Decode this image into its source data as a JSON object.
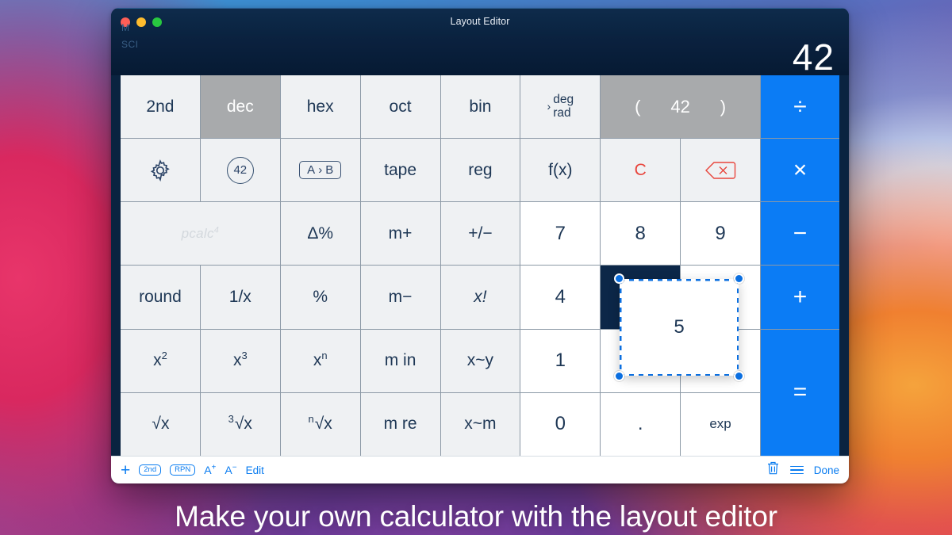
{
  "window": {
    "title": "Layout Editor",
    "traffic_lights": [
      "close",
      "minimize",
      "zoom"
    ]
  },
  "display": {
    "flag_memory": "M",
    "flag_mode": "SCI",
    "value": "42"
  },
  "colors": {
    "accent_blue": "#0b7cf5",
    "toolbar_blue": "#0a7cf0",
    "key_face": "#eff1f3",
    "number_key_face": "#ffffff",
    "gray_key": "#a8aaac",
    "selected_slot": "#0c2748",
    "red": "#e8453c",
    "text": "#1e3755"
  },
  "keypad": {
    "rows": [
      [
        {
          "name": "2nd",
          "label": "2nd",
          "style": "func"
        },
        {
          "name": "dec",
          "label": "dec",
          "style": "gray"
        },
        {
          "name": "hex",
          "label": "hex",
          "style": "func"
        },
        {
          "name": "oct",
          "label": "oct",
          "style": "func"
        },
        {
          "name": "bin",
          "label": "bin",
          "style": "func"
        },
        {
          "name": "deg-rad",
          "label": "deg rad",
          "style": "degrad",
          "line1": "deg",
          "line2": "rad",
          "chevron": "›"
        },
        {
          "name": "paren-group",
          "label": "( 42 )",
          "style": "paren",
          "open": "(",
          "value": "42",
          "close": ")",
          "span": 2
        },
        {
          "name": "divide",
          "label": "÷",
          "style": "op"
        }
      ],
      [
        {
          "name": "settings",
          "label": "gear-icon",
          "style": "icon-gear"
        },
        {
          "name": "constants",
          "label": "42",
          "style": "circle42"
        },
        {
          "name": "convert",
          "label": "A › B",
          "style": "abbox",
          "from": "A",
          "arrow": "›",
          "to": "B"
        },
        {
          "name": "tape",
          "label": "tape",
          "style": "func"
        },
        {
          "name": "reg",
          "label": "reg",
          "style": "func"
        },
        {
          "name": "fx",
          "label": "f(x)",
          "style": "func"
        },
        {
          "name": "clear",
          "label": "C",
          "style": "red"
        },
        {
          "name": "backspace",
          "label": "backspace-icon",
          "style": "icon-backspace"
        },
        {
          "name": "multiply",
          "label": "×",
          "style": "op"
        }
      ],
      [
        {
          "name": "pcalc-logo",
          "label": "pcalc",
          "sup": "4",
          "style": "logo",
          "span": 2
        },
        {
          "name": "delta-percent",
          "label": "Δ%",
          "style": "func"
        },
        {
          "name": "memory-plus",
          "label": "m+",
          "style": "func"
        },
        {
          "name": "sign",
          "label": "+/−",
          "style": "func"
        },
        {
          "name": "seven",
          "label": "7",
          "style": "num"
        },
        {
          "name": "eight",
          "label": "8",
          "style": "num"
        },
        {
          "name": "nine",
          "label": "9",
          "style": "num"
        },
        {
          "name": "minus",
          "label": "−",
          "style": "op"
        }
      ],
      [
        {
          "name": "round",
          "label": "round",
          "style": "func"
        },
        {
          "name": "reciprocal",
          "label": "1/x",
          "style": "func"
        },
        {
          "name": "percent",
          "label": "%",
          "style": "func"
        },
        {
          "name": "memory-minus",
          "label": "m−",
          "style": "func"
        },
        {
          "name": "factorial",
          "label": "x!",
          "style": "func-ital"
        },
        {
          "name": "four",
          "label": "4",
          "style": "num"
        },
        {
          "name": "empty-slot",
          "label": "",
          "style": "empty"
        },
        {
          "name": "five-placeholder",
          "label": "",
          "style": "num-hidden"
        },
        {
          "name": "plus",
          "label": "+",
          "style": "op"
        }
      ],
      [
        {
          "name": "x-squared",
          "label": "x",
          "sup": "2",
          "style": "func-sup"
        },
        {
          "name": "x-cubed",
          "label": "x",
          "sup": "3",
          "style": "func-sup"
        },
        {
          "name": "x-power-n",
          "label": "x",
          "sup": "n",
          "style": "func-sup"
        },
        {
          "name": "memory-in",
          "label": "m in",
          "style": "func"
        },
        {
          "name": "swap-xy",
          "label": "x~y",
          "style": "func"
        },
        {
          "name": "one",
          "label": "1",
          "style": "num"
        },
        {
          "name": "empty-slot-2",
          "label": "",
          "style": "num-plain"
        },
        {
          "name": "empty-slot-3",
          "label": "",
          "style": "num-plain"
        },
        {
          "name": "equals",
          "label": "=",
          "style": "op"
        }
      ],
      [
        {
          "name": "square-root",
          "label": "√x",
          "style": "func-root",
          "index": ""
        },
        {
          "name": "cube-root",
          "label": "√x",
          "style": "func-root",
          "index": "3"
        },
        {
          "name": "nth-root",
          "label": "√x",
          "style": "func-root",
          "index": "n"
        },
        {
          "name": "memory-recall",
          "label": "m re",
          "style": "func"
        },
        {
          "name": "swap-xm",
          "label": "x~m",
          "style": "func"
        },
        {
          "name": "zero",
          "label": "0",
          "style": "num"
        },
        {
          "name": "decimal-point",
          "label": ".",
          "style": "num"
        },
        {
          "name": "exponent",
          "label": "exp",
          "style": "num-sm"
        }
      ]
    ]
  },
  "dragged_key": {
    "label": "5",
    "name": "five-key-selected",
    "handles": 4
  },
  "toolbar": {
    "add_label": "+",
    "second_label": "2nd",
    "rpn_label": "RPN",
    "font_bigger_label": "A",
    "font_bigger_sup": "+",
    "font_smaller_label": "A",
    "font_smaller_sup": "−",
    "edit_label": "Edit",
    "trash_label": "trash-icon",
    "menu_label": "menu-icon",
    "done_label": "Done"
  },
  "caption": {
    "text": "Make your own calculator with the layout editor"
  }
}
